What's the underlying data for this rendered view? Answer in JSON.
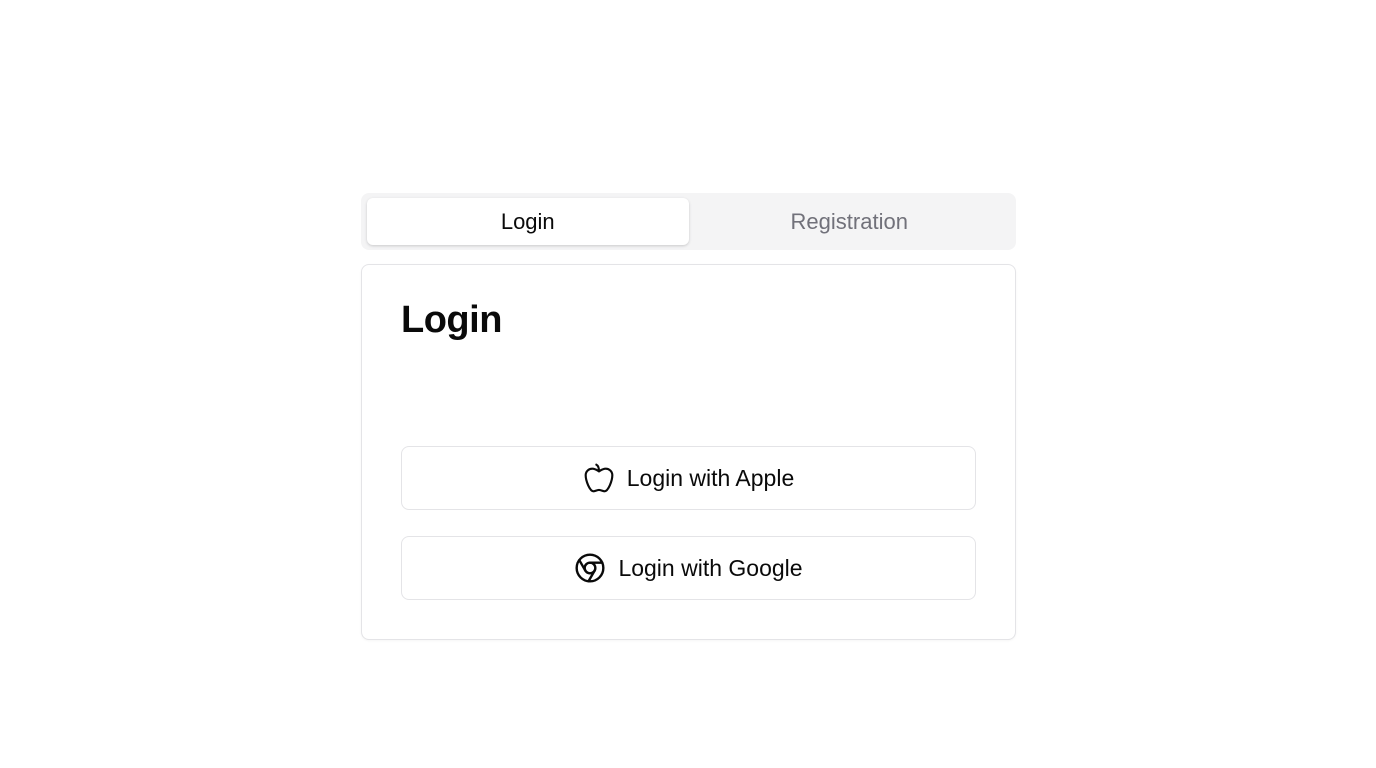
{
  "tabs": [
    {
      "label": "Login",
      "active": true
    },
    {
      "label": "Registration",
      "active": false
    }
  ],
  "card": {
    "title": "Login",
    "buttons": {
      "apple": {
        "label": "Login with Apple",
        "icon": "apple-icon"
      },
      "google": {
        "label": "Login with Google",
        "icon": "chrome-icon"
      }
    }
  },
  "colors": {
    "tab_bar_bg": "#f4f4f5",
    "inactive_tab_text": "#71717a",
    "text": "#0a0a0a",
    "border": "#e4e4e7"
  }
}
